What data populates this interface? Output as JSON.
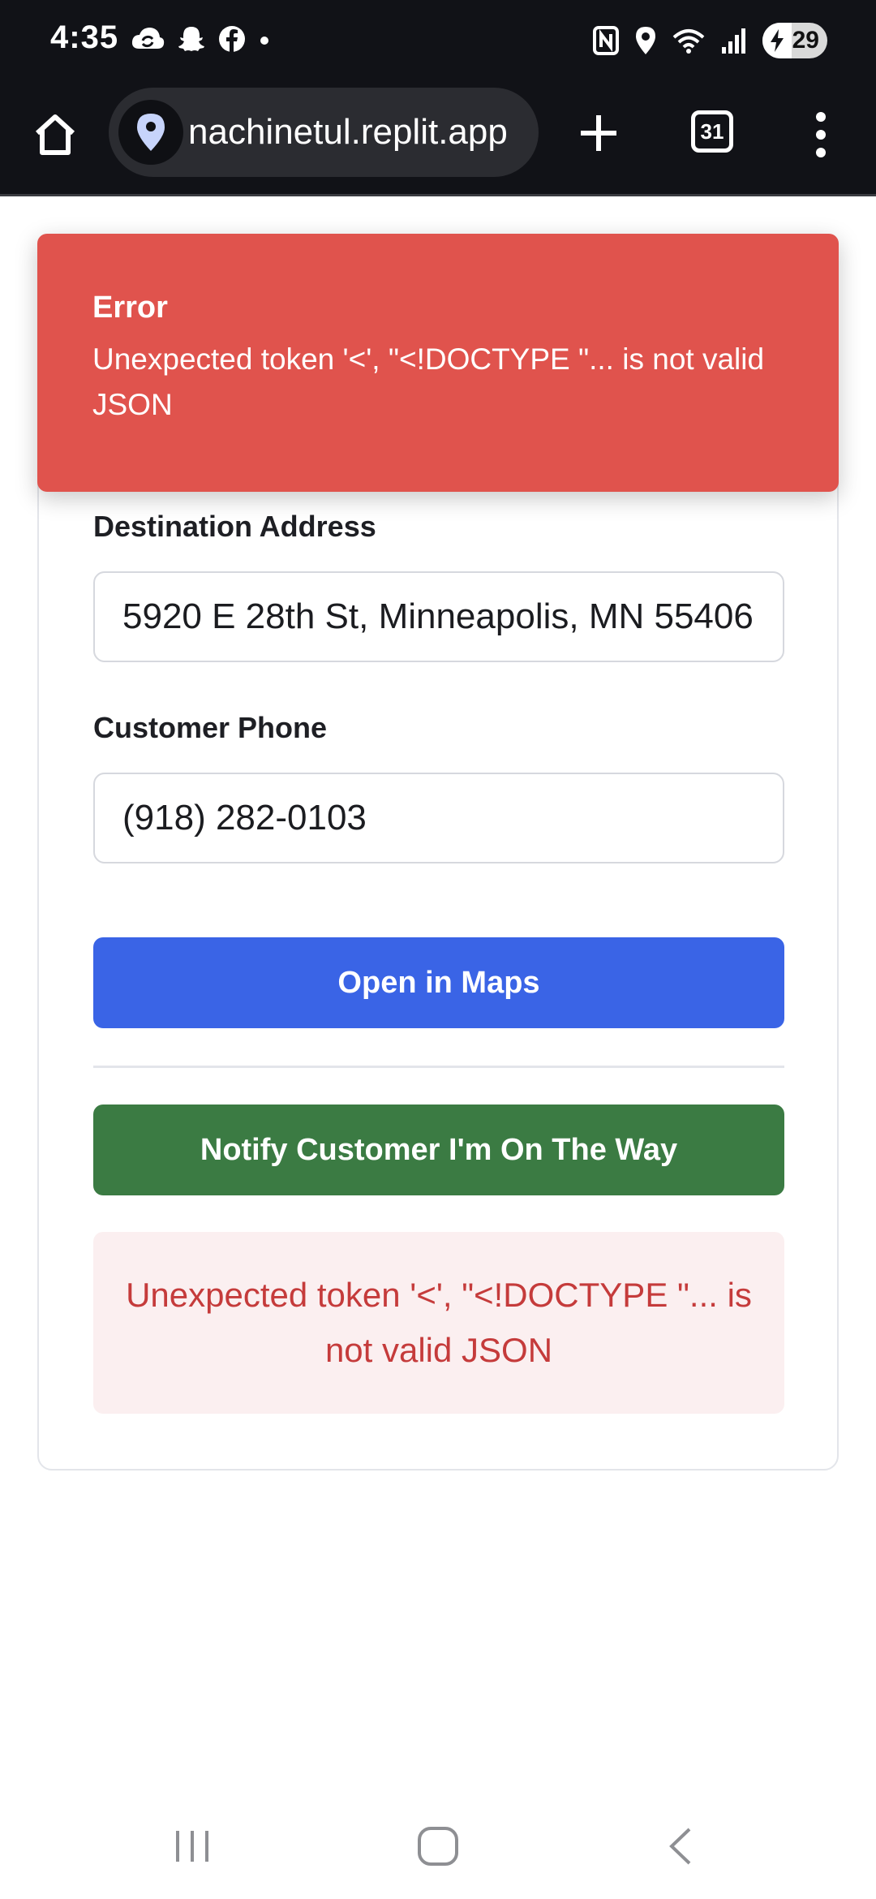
{
  "status_bar": {
    "time": "4:35",
    "left_icons": [
      "cloud-sync-icon",
      "snapchat-icon",
      "facebook-icon",
      "dot-icon"
    ],
    "right_icons": [
      "nfc-icon",
      "location-icon",
      "wifi-icon",
      "signal-icon"
    ],
    "battery_level": "29"
  },
  "browser": {
    "url": "nachinetul.replit.app",
    "tab_count": "31"
  },
  "toast": {
    "title": "Error",
    "message": "Unexpected token '<', \"<!DOCTYPE \"... is not valid JSON",
    "color": "#e0534d"
  },
  "form": {
    "destination_label": "Destination Address",
    "destination_value": "5920 E 28th St, Minneapolis, MN 55406",
    "phone_label": "Customer Phone",
    "phone_value": "(918) 282-0103"
  },
  "buttons": {
    "maps_label": "Open in Maps",
    "notify_label": "Notify Customer I'm On The Way",
    "maps_color": "#3a64e6",
    "notify_color": "#3b7b43"
  },
  "inline_error": {
    "message": "Unexpected token '<', \"<!DOCTYPE \"... is not valid JSON"
  }
}
